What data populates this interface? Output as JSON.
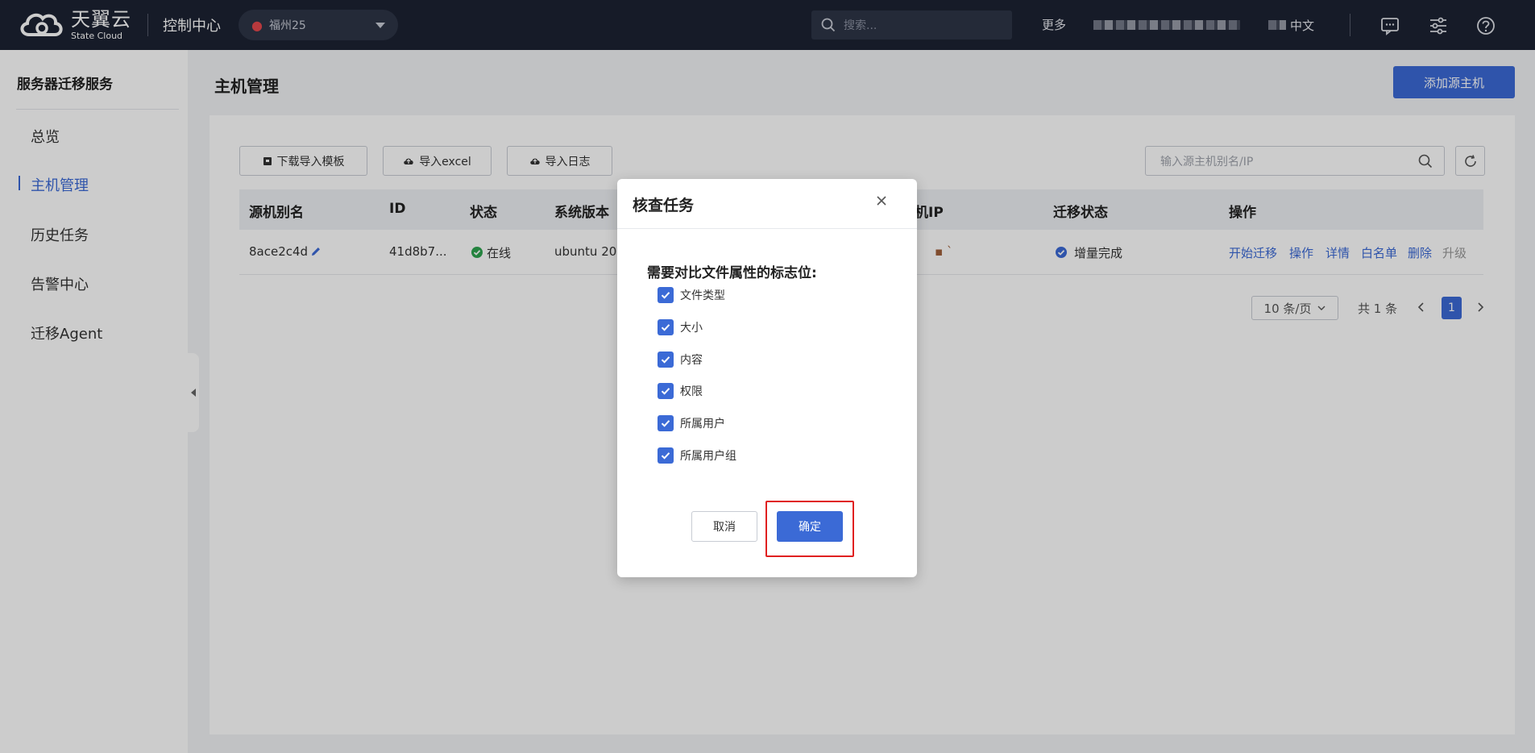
{
  "topbar": {
    "logo_cn": "天翼云",
    "logo_en": "State Cloud",
    "console": "控制中心",
    "region": "福州25",
    "search_placeholder": "搜索...",
    "more": "更多",
    "lang": "中文"
  },
  "sidebar": {
    "title": "服务器迁移服务",
    "items": [
      {
        "label": "总览"
      },
      {
        "label": "主机管理"
      },
      {
        "label": "历史任务"
      },
      {
        "label": "告警中心"
      },
      {
        "label": "迁移Agent"
      }
    ]
  },
  "main": {
    "title": "主机管理",
    "add_button": "添加源主机",
    "toolbar": {
      "download": "下载导入模板",
      "import_excel": "导入excel",
      "import_log": "导入日志",
      "search_placeholder": "输入源主机别名/IP"
    },
    "table": {
      "headers": [
        "源机别名",
        "ID",
        "状态",
        "系统版本",
        "机IP",
        "迁移状态",
        "操作"
      ],
      "row": {
        "alias": "8ace2c4d",
        "id": "41d8b7...",
        "status": "在线",
        "os": "ubuntu 20.",
        "ip": "▪ `",
        "migrate_status": "增量完成",
        "actions": [
          "开始迁移",
          "操作",
          "详情",
          "白名单",
          "删除",
          "升级"
        ]
      }
    },
    "pagination": {
      "page_size": "10 条/页",
      "total": "共 1 条",
      "current_page": "1"
    }
  },
  "modal": {
    "title": "核查任务",
    "label": "需要对比文件属性的标志位:",
    "options": [
      {
        "label": "文件类型",
        "checked": true
      },
      {
        "label": "大小",
        "checked": true
      },
      {
        "label": "内容",
        "checked": true
      },
      {
        "label": "权限",
        "checked": true
      },
      {
        "label": "所属用户",
        "checked": true
      },
      {
        "label": "所属用户组",
        "checked": true
      }
    ],
    "cancel": "取消",
    "confirm": "确定"
  },
  "colors": {
    "primary": "#3b6ad6",
    "topbar": "#1c2233",
    "highlight": "#e02020"
  }
}
